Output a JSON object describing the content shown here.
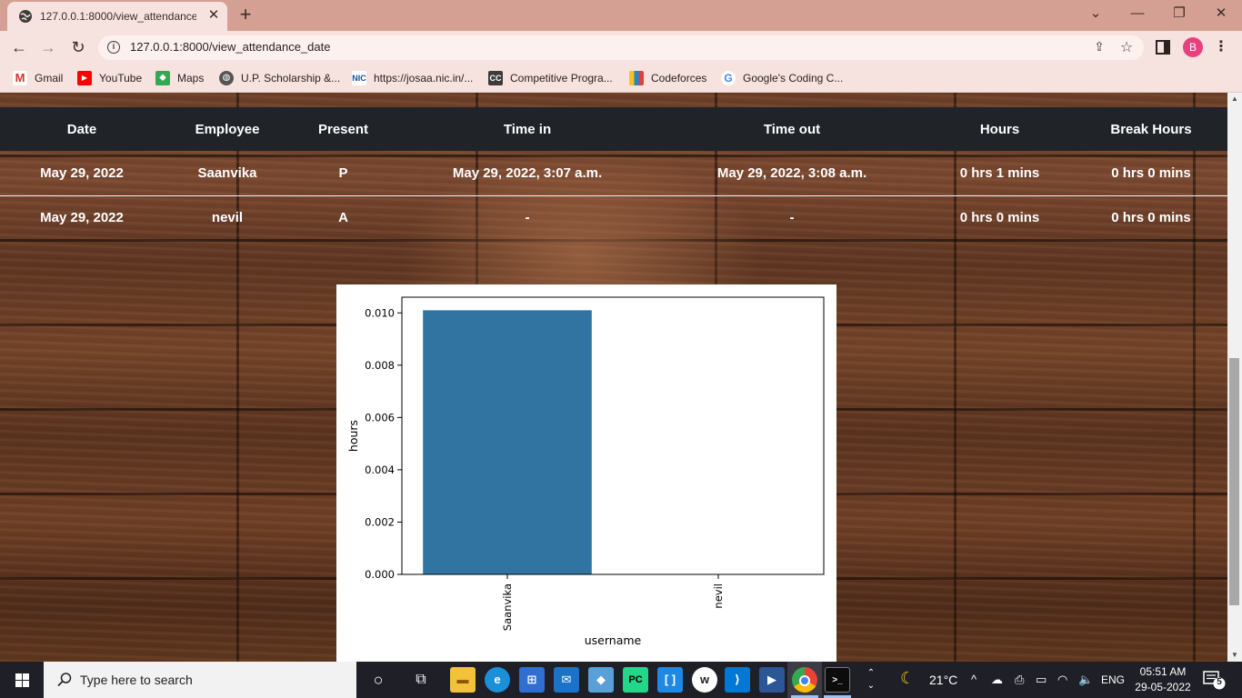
{
  "browser": {
    "tab_title": "127.0.0.1:8000/view_attendance_",
    "url": "127.0.0.1:8000/view_attendance_date",
    "profile_initial": "B",
    "bookmarks": [
      {
        "label": "Gmail",
        "icon": "gmail-icon"
      },
      {
        "label": "YouTube",
        "icon": "youtube-icon"
      },
      {
        "label": "Maps",
        "icon": "maps-icon"
      },
      {
        "label": "U.P. Scholarship &...",
        "icon": "globe-icon"
      },
      {
        "label": "https://josaa.nic.in/...",
        "icon": "nic-icon"
      },
      {
        "label": "Competitive Progra...",
        "icon": "cc-icon"
      },
      {
        "label": "Codeforces",
        "icon": "codeforces-icon"
      },
      {
        "label": "Google's Coding C...",
        "icon": "google-icon"
      }
    ]
  },
  "table": {
    "headers": [
      "Date",
      "Employee",
      "Present",
      "Time in",
      "Time out",
      "Hours",
      "Break Hours"
    ],
    "rows": [
      [
        "May 29, 2022",
        "Saanvika",
        "P",
        "May 29, 2022, 3:07 a.m.",
        "May 29, 2022, 3:08 a.m.",
        "0 hrs 1 mins",
        "0 hrs 0 mins"
      ],
      [
        "May 29, 2022",
        "nevil",
        "A",
        "-",
        "-",
        "0 hrs 0 mins",
        "0 hrs 0 mins"
      ]
    ]
  },
  "chart_data": {
    "type": "bar",
    "categories": [
      "Saanvika",
      "nevil"
    ],
    "values": [
      0.0101,
      0
    ],
    "xlabel": "username",
    "ylabel": "hours",
    "ylim": [
      0,
      0.0106
    ],
    "yticks": [
      "0.000",
      "0.002",
      "0.004",
      "0.006",
      "0.008",
      "0.010"
    ],
    "bar_color": "#3274a1",
    "grid": false
  },
  "taskbar": {
    "search_placeholder": "Type here to search",
    "weather": "21°C",
    "language": "ENG",
    "time": "05:51 AM",
    "date": "29-05-2022",
    "notification_count": "5"
  }
}
